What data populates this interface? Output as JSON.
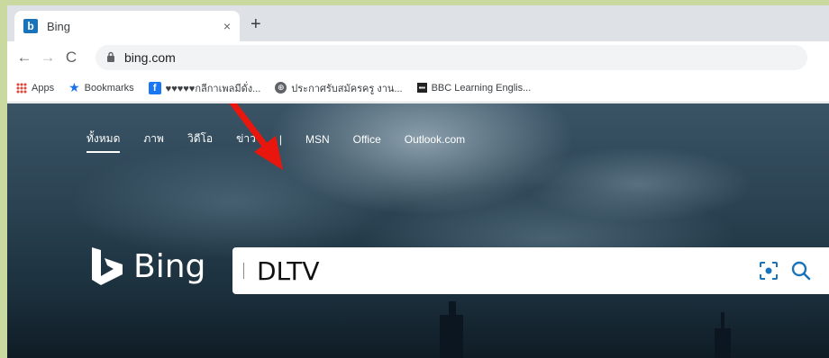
{
  "browser": {
    "tab": {
      "title": "Bing",
      "close": "×"
    },
    "new_tab": "+",
    "url": "bing.com"
  },
  "bookmarks": [
    {
      "label": "Apps",
      "icon": "apps-grid-icon"
    },
    {
      "label": "Bookmarks",
      "icon": "star-icon"
    },
    {
      "label": "♥♥♥♥♥กลีกาเพลมีดั่ง...",
      "icon": "facebook-icon"
    },
    {
      "label": "ประกาศรับสมัครครู งาน...",
      "icon": "globe-icon"
    },
    {
      "label": "BBC Learning Englis...",
      "icon": "bbc-icon"
    }
  ],
  "bing": {
    "nav": [
      "ทั้งหมด",
      "ภาพ",
      "วิดีโอ",
      "ข่าว",
      "|",
      "MSN",
      "Office",
      "Outlook.com"
    ],
    "logo_text": "Bing",
    "search_value": "DLTV"
  },
  "colors": {
    "arrow": "#e8160c",
    "bing_blue": "#1a73b8"
  }
}
